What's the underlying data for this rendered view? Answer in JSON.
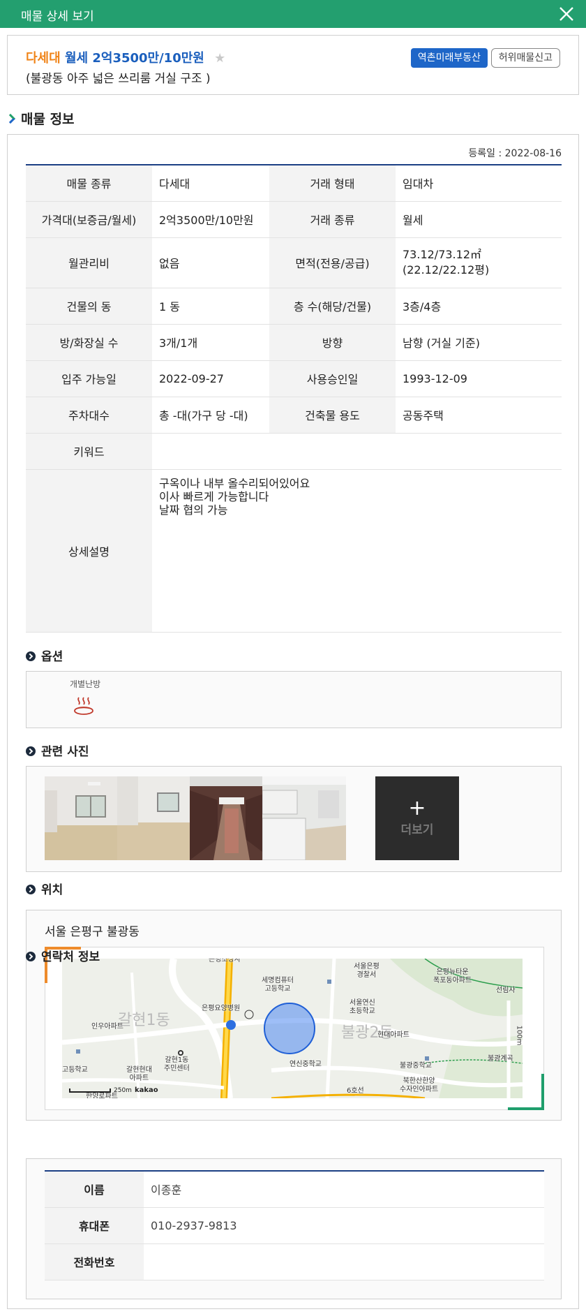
{
  "header": {
    "title": "매물 상세 보기",
    "close_icon": "close-icon"
  },
  "listing": {
    "type": "다세대",
    "price": "월세 2억3500만/10만원",
    "subtitle": "(불광동 아주 넓은 쓰리룸 거실 구조 )",
    "agency_button": "역촌미래부동산",
    "report_button": "허위매물신고",
    "favorite_icon": "star-icon"
  },
  "section_title": "매물 정보",
  "reg_date": "등록일 : 2022-08-16",
  "info": {
    "rows": [
      [
        {
          "label": "매물 종류",
          "value": "다세대"
        },
        {
          "label": "거래 형태",
          "value": "임대차"
        }
      ],
      [
        {
          "label": "가격대(보증금/월세)",
          "value": "2억3500만/10만원"
        },
        {
          "label": "거래 종류",
          "value": "월세"
        }
      ],
      [
        {
          "label": "월관리비",
          "value": "없음"
        },
        {
          "label": "면적(전용/공급)",
          "value": "73.12/73.12㎡\n(22.12/22.12평)"
        }
      ],
      [
        {
          "label": "건물의 동",
          "value": "1 동"
        },
        {
          "label": "층 수(해당/건물)",
          "value": "3층/4층"
        }
      ],
      [
        {
          "label": "방/화장실 수",
          "value": "3개/1개"
        },
        {
          "label": "방향",
          "value": "남향 (거실 기준)"
        }
      ],
      [
        {
          "label": "입주 가능일",
          "value": "2022-09-27"
        },
        {
          "label": "사용승인일",
          "value": "1993-12-09"
        }
      ],
      [
        {
          "label": "주차대수",
          "value": "총 -대(가구 당 -대)"
        },
        {
          "label": "건축물 용도",
          "value": "공동주택"
        }
      ]
    ],
    "keyword_label": "키워드",
    "keyword_value": "",
    "desc_label": "상세설명",
    "desc_value": "구옥이나 내부 올수리되어있어요\n이사 빠르게 가능합니다\n날짜 협의 가능"
  },
  "options": {
    "title": "옵션",
    "items": [
      {
        "label": "개별난방",
        "icon": "heating-icon"
      }
    ]
  },
  "photos": {
    "title": "관련 사진",
    "more_label": "더보기"
  },
  "location": {
    "title": "위치",
    "address": "서울 은평구 불광동",
    "map_labels": {
      "l1": "세명컴퓨터\n고등학교",
      "l2": "서울은평\n경찰서",
      "l3": "은평뉴타운\n폭포동아파트",
      "l4": "선림사",
      "l5": "은평요양병원",
      "l6": "서울연신\n초등학교",
      "l7": "인우아파트",
      "l8": "현대아파트",
      "l9": "갈현1동\n주민센터",
      "l10": "연신중학교",
      "l11": "불광중학교",
      "l12": "불광계곡",
      "l13": "갈현현대\n아파트",
      "l14": "북한산한양\n수자인아파트",
      "l15": "고등학교",
      "l16": "한양로파트",
      "l17": "6호선",
      "l18": "은평조상사",
      "l19": "100m",
      "big1": "갈현1동",
      "big2": "불광2동"
    },
    "scale": "250m",
    "brand": "kakao"
  },
  "contact": {
    "title": "연락처 정보",
    "rows": [
      {
        "label": "이름",
        "value": "이종훈"
      },
      {
        "label": "휴대폰",
        "value": "010-2937-9813"
      },
      {
        "label": "전화번호",
        "value": ""
      }
    ]
  }
}
